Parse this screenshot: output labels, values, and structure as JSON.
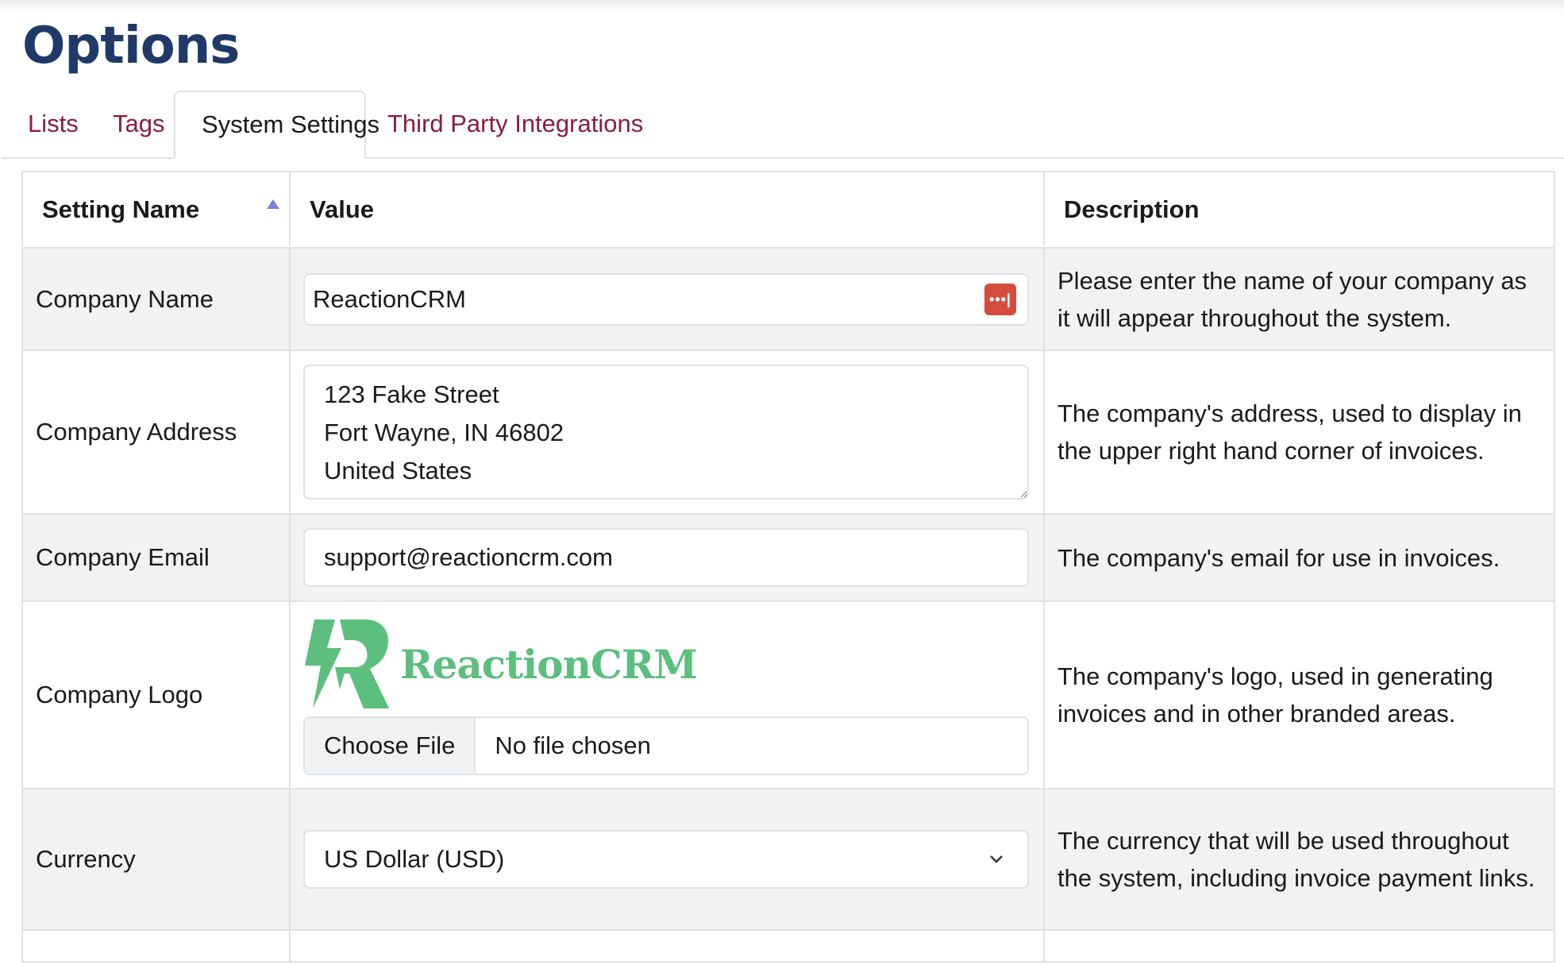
{
  "page": {
    "title": "Options"
  },
  "tabs": [
    {
      "label": "Lists",
      "active": false
    },
    {
      "label": "Tags",
      "active": false
    },
    {
      "label": "System Settings",
      "active": true
    },
    {
      "label": "Third Party Integrations",
      "active": false
    }
  ],
  "table": {
    "headers": {
      "name": "Setting Name",
      "value": "Value",
      "description": "Description"
    },
    "rows": {
      "company_name": {
        "name": "Company Name",
        "value": "ReactionCRM",
        "description": "Please enter the name of your company as it will appear throughout the system."
      },
      "company_address": {
        "name": "Company Address",
        "value": "123 Fake Street\nFort Wayne, IN 46802\nUnited States",
        "description": "The company's address, used to display in the upper right hand corner of invoices."
      },
      "company_email": {
        "name": "Company Email",
        "value": "support@reactioncrm.com",
        "description": "The company's email for use in invoices."
      },
      "company_logo": {
        "name": "Company Logo",
        "logo_text": "ReactionCRM",
        "file_button": "Choose File",
        "file_status": "No file chosen",
        "description": "The company's logo, used in generating invoices and in other branded areas."
      },
      "currency": {
        "name": "Currency",
        "selected": "US Dollar (USD)",
        "description": "The currency that will be used throughout the system, including invoice payment links."
      }
    }
  },
  "colors": {
    "title": "#1f3a68",
    "tab_link": "#8b1d3b",
    "logo_green": "#5cbf7d",
    "password_icon": "#d44c3d",
    "sort_icon": "#7b7fd6"
  },
  "icons": {
    "sort": "sort-ascending-icon",
    "password_manager": "password-manager-icon",
    "dropdown": "chevron-down-icon"
  }
}
